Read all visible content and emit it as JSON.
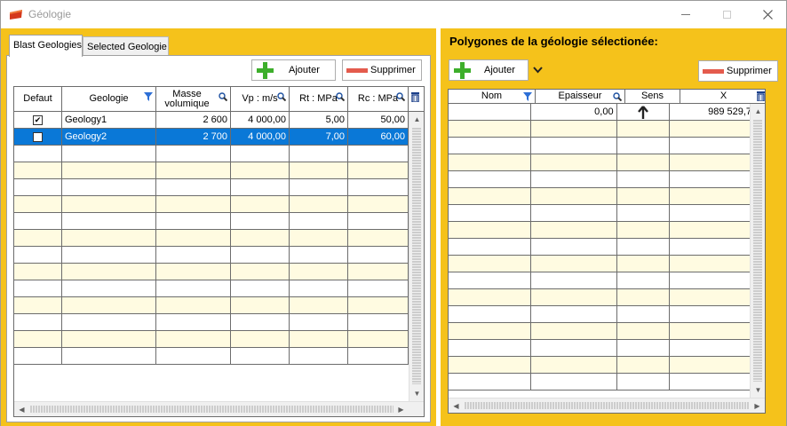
{
  "window": {
    "title": "Géologie"
  },
  "left": {
    "tabs": [
      {
        "label": "Blast Geologies"
      },
      {
        "label": "Selected Geologie"
      }
    ],
    "add_label": "Ajouter",
    "remove_label": "Supprimer",
    "columns": [
      "Defaut",
      "Geologie",
      "Masse volumique",
      "Vp : m/s",
      "Rt : MPa",
      "Rc : MPa"
    ],
    "rows": [
      {
        "default_checked": true,
        "name": "Geology1",
        "masse": "2 600",
        "vp": "4 000,00",
        "rt": "5,00",
        "rc": "50,00"
      },
      {
        "default_checked": false,
        "name": "Geology2",
        "masse": "2 700",
        "vp": "4 000,00",
        "rt": "7,00",
        "rc": "60,00"
      }
    ]
  },
  "right": {
    "title": "Polygones de la géologie sélectionée:",
    "add_label": "Ajouter",
    "remove_label": "Supprimer",
    "columns": [
      "Nom",
      "Epaisseur",
      "Sens",
      "X"
    ],
    "rows": [
      {
        "nom": "",
        "epaisseur": "0,00",
        "sens": "up-arrow-icon",
        "x": "989 529,7"
      }
    ]
  },
  "colors": {
    "background": "#f5c21b",
    "selected_row": "#0a78d7",
    "alt_row": "#fffbe1",
    "plus": "#3dae2b",
    "minus": "#e45b4d"
  }
}
